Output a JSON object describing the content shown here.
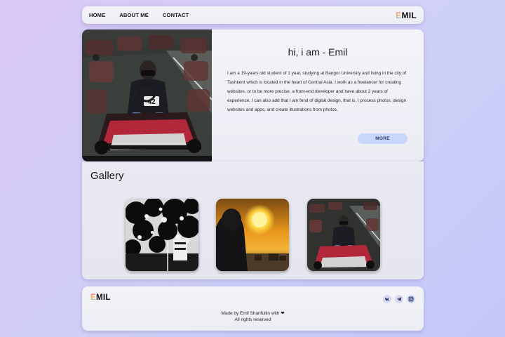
{
  "nav": {
    "links": [
      "HOME",
      "ABOUT ME",
      "CONTACT"
    ],
    "logo_first": "E",
    "logo_rest": "MIL"
  },
  "hero": {
    "title": "hi, i am - Emil",
    "bio": "I am a 19-years old student of 1 year, studying at Bangor University and living in the city of Tashkent which is located in the heart of Central Asia. I work as a freelancer for creating websites, or to be more precise, a front-end developer and have about 2 years of experience. I can also add that I am fond of digital design, that is, I process photos, design websites and apps, and create illustrations from photos.",
    "more_label": "MORE",
    "photo_kart_number": "42"
  },
  "gallery": {
    "title": "Gallery"
  },
  "footer": {
    "logo_first": "E",
    "logo_rest": "MIL",
    "credit_prefix": "Made by Emil Sharifullin with",
    "heart_symbol": "❤",
    "rights": "All rights reserved",
    "socials": [
      "vk-icon",
      "telegram-icon",
      "instagram-icon"
    ]
  },
  "colors": {
    "more_button": "#c9d7fb",
    "background_start": "#d9c8f5",
    "background_end": "#c4c8f9"
  }
}
